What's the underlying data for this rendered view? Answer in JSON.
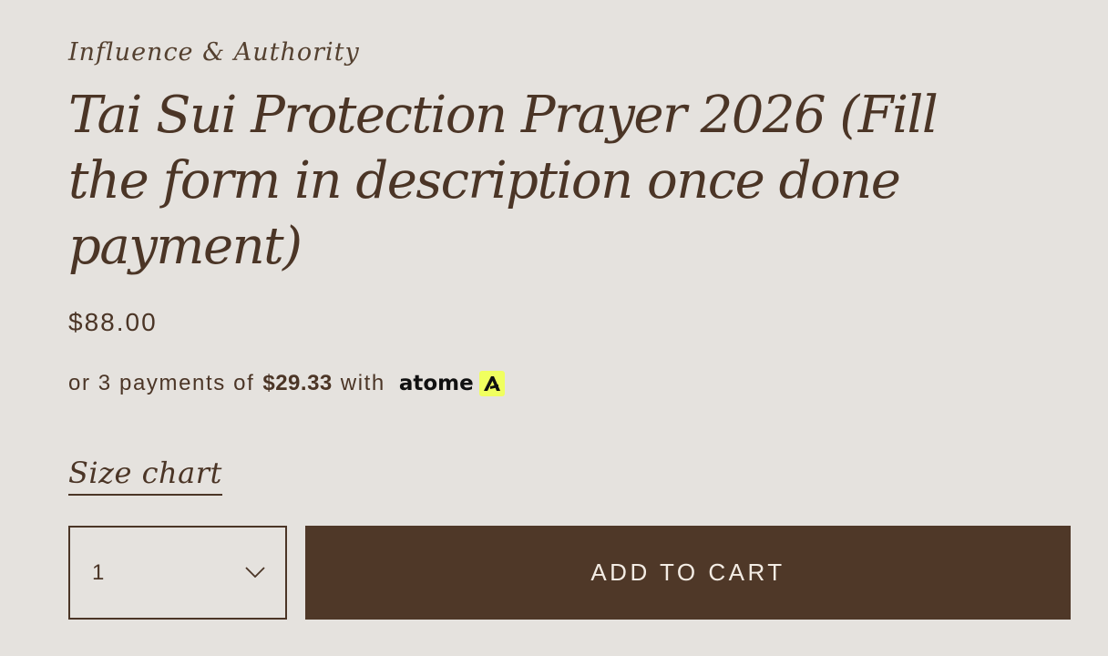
{
  "product": {
    "vendor": "Influence & Authority",
    "title": "Tai Sui Protection Prayer 2026 (Fill the form in description once done payment)",
    "price": "$88.00"
  },
  "installments": {
    "prefix": "or 3 payments of",
    "amount": "$29.33",
    "suffix": "with",
    "provider": "atome",
    "provider_badge_color": "#f0ff5f"
  },
  "size_chart": {
    "label": "Size chart"
  },
  "quantity": {
    "value": "1",
    "icon": "chevron-down-icon"
  },
  "cart": {
    "add_label": "ADD TO CART"
  },
  "colors": {
    "background": "#e5e2de",
    "text": "#4b3526",
    "button": "#4f3828"
  }
}
